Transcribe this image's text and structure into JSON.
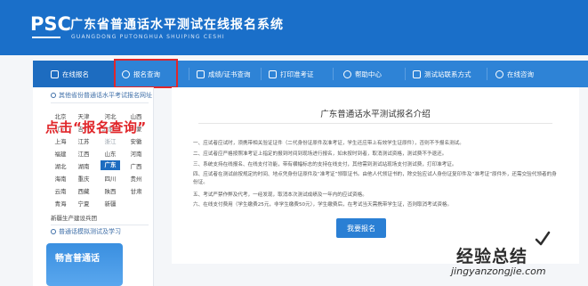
{
  "header": {
    "logo": "PSC",
    "title": "广东省普通话水平测试在线报名系统",
    "subtitle": "GUANGDONG PUTONGHUA SHUIPING CESHI"
  },
  "nav": {
    "items": [
      {
        "label": "在线报名",
        "icon": "register-icon"
      },
      {
        "label": "报名查询",
        "icon": "search-icon"
      },
      {
        "label": "成绩/证书查询",
        "icon": "certificate-icon"
      },
      {
        "label": "打印准考证",
        "icon": "printer-icon"
      },
      {
        "label": "帮助中心",
        "icon": "help-icon"
      },
      {
        "label": "测试站联系方式",
        "icon": "contact-icon"
      },
      {
        "label": "在线咨询",
        "icon": "chat-icon"
      }
    ]
  },
  "sidebar": {
    "other_provinces_heading": "其他省份普通话水平考试报名网址",
    "provinces": [
      [
        "北京",
        "天津",
        "河北",
        "山西"
      ],
      [
        "辽宁",
        "吉林",
        "黑龙江",
        "内蒙"
      ],
      [
        "上海",
        "江苏",
        "浙江",
        "安徽"
      ],
      [
        "福建",
        "江西",
        "山东",
        "河南"
      ],
      [
        "湖北",
        "湖南",
        "广东",
        "广西"
      ],
      [
        "海南",
        "重庆",
        "四川",
        "贵州"
      ],
      [
        "云南",
        "西藏",
        "陕西",
        "甘肃"
      ],
      [
        "青海",
        "宁夏",
        "新疆",
        ""
      ]
    ],
    "active_province": "广东",
    "xinjiang_corps": "新疆生产建设兵团",
    "practice_heading": "普通话模拟测试及学习",
    "promo_title": "畅言普通话"
  },
  "annotation": "点击“报名查询”",
  "main": {
    "title": "广东普通话水平测试报名介绍",
    "rules": [
      "一、应试者应试时，须携带相关验证证件（二代身份证原件及准考证，学生还应带上有效学生证原件），否则不予报名测试。",
      "二、应试者应严格按照准考证上指定的报到时间到现场进行报名，如未按时到者，取消测试资格，测试费不予退还。",
      "三、系统支持在线报名、在线支付功能，带有横幅标志的支持在线支付，其他需到测试站现场支付测试费，打印准考证。",
      "四、应试者在测试前按规定的时间、地点凭身份证原件及“准考证”领取证书。由他人代领证书的，除交验应试人身份证复印件及“准考证”原件外，还需交验代领者的身份证。",
      "五、考试严禁作弊及代考，一经发现，取消本次测试成绩及一年内的应试资格。",
      "六、在线支付费用（学生缴费25元，非学生缴费50元），学生缴费后，在考试当天需携带学生证，否则取消考试资格。"
    ],
    "apply_button": "我要报名"
  },
  "watermark": {
    "cn": "经验总结",
    "en": "jingyanzongjie.com"
  },
  "colors": {
    "header_blue": "#1a6fc9",
    "nav_blue": "#2e83d6",
    "highlight_red": "#e0262a"
  }
}
